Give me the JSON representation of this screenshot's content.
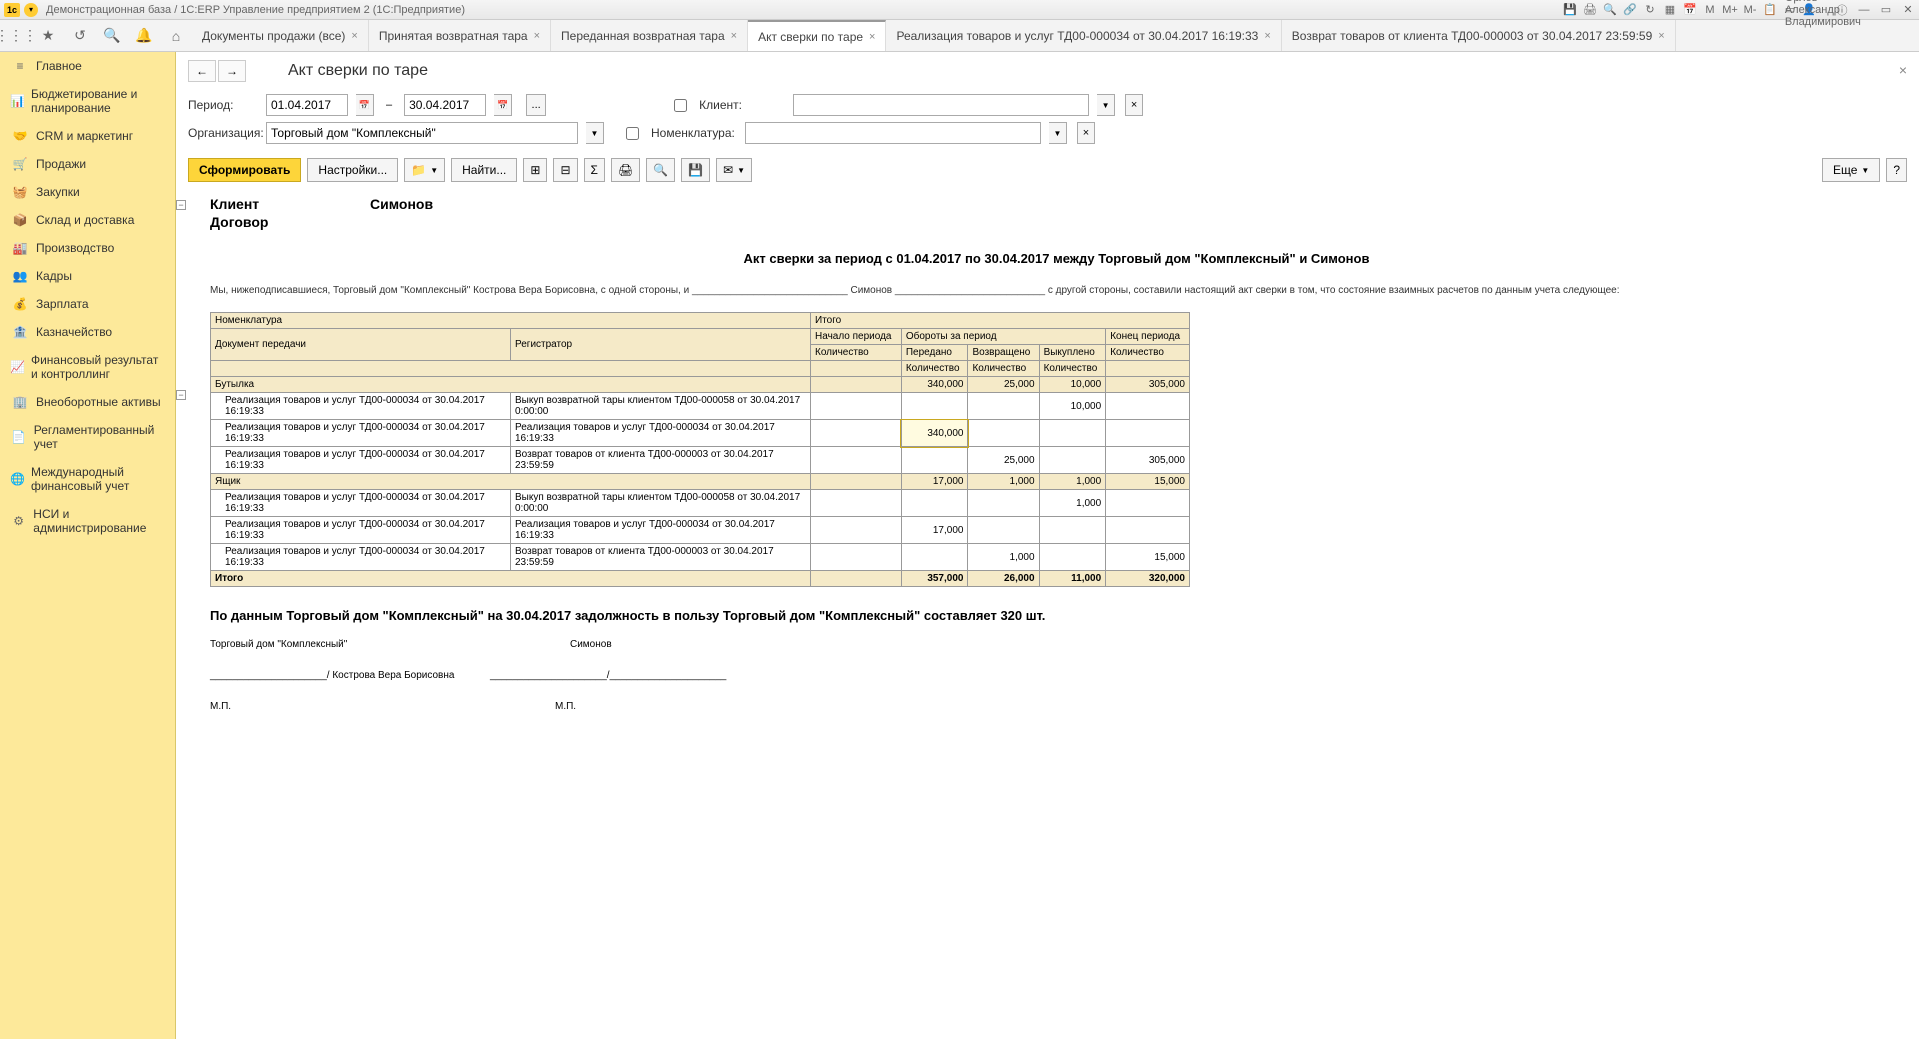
{
  "titlebar": {
    "title": "Демонстрационная база / 1С:ERP Управление предприятием 2  (1С:Предприятие)",
    "user": "Орлов Александр Владимирович"
  },
  "tabs": [
    "Документы продажи (все)",
    "Принятая возвратная тара",
    "Переданная возвратная тара",
    "Акт сверки по таре",
    "Реализация товаров и услуг ТД00-000034 от 30.04.2017 16:19:33",
    "Возврат товаров от клиента ТД00-000003 от 30.04.2017 23:59:59"
  ],
  "sidebar": [
    "Главное",
    "Бюджетирование и планирование",
    "CRM и маркетинг",
    "Продажи",
    "Закупки",
    "Склад и доставка",
    "Производство",
    "Кадры",
    "Зарплата",
    "Казначейство",
    "Финансовый результат и контроллинг",
    "Внеоборотные активы",
    "Регламентированный учет",
    "Международный финансовый учет",
    "НСИ и администрирование"
  ],
  "page": {
    "title": "Акт сверки по таре",
    "period_label": "Период:",
    "date_from": "01.04.2017",
    "date_to": "30.04.2017",
    "org_label": "Организация:",
    "org_value": "Торговый дом \"Комплексный\"",
    "client_label": "Клиент:",
    "nomen_label": "Номенклатура:"
  },
  "toolbar": {
    "form": "Сформировать",
    "settings": "Настройки...",
    "find": "Найти...",
    "more": "Еще"
  },
  "report": {
    "client_label": "Клиент",
    "client_value": "Симонов",
    "contract_label": "Договор",
    "title": "Акт сверки за период с 01.04.2017 по 30.04.2017 между Торговый дом \"Комплексный\" и Симонов",
    "preamble1": "Мы, нижеподписавшиеся,  Торговый дом \"Комплексный\" Кострова Вера Борисовна, с одной стороны, и ____________________________ Симонов",
    "preamble2": "___________________________ с другой стороны, составили настоящий акт сверки в том, что состояние взаимных расчетов по данным учета следующее:",
    "headers": {
      "h1": "Номенклатура",
      "h2": "Итого",
      "h3": "Документ передачи",
      "h4": "Регистратор",
      "h5": "Начало периода",
      "h6": "Обороты за период",
      "h7": "Конец периода",
      "h8": "Количество",
      "h9": "Передано",
      "h10": "Возвращено",
      "h11": "Выкуплено",
      "h12": "Количество",
      "h13": "Количество",
      "h14": "Количество",
      "h15": "Количество"
    },
    "group1": {
      "name": "Бутылка",
      "peredano": "340,000",
      "vozvr": "25,000",
      "vykup": "10,000",
      "konec": "305,000",
      "rows": [
        {
          "doc": "Реализация товаров и услуг ТД00-000034 от 30.04.2017 16:19:33",
          "reg": "Выкуп возвратной тары клиентом ТД00-000058 от 30.04.2017 0:00:00",
          "c3": "",
          "c4": "",
          "c5": "10,000",
          "c6": ""
        },
        {
          "doc": "Реализация товаров и услуг ТД00-000034 от 30.04.2017 16:19:33",
          "reg": "Реализация товаров и услуг ТД00-000034 от 30.04.2017 16:19:33",
          "c3": "340,000",
          "c4": "",
          "c5": "",
          "c6": "",
          "hl": true
        },
        {
          "doc": "Реализация товаров и услуг ТД00-000034 от 30.04.2017 16:19:33",
          "reg": "Возврат товаров от клиента ТД00-000003 от 30.04.2017 23:59:59",
          "c3": "",
          "c4": "25,000",
          "c5": "",
          "c6": "305,000"
        }
      ]
    },
    "group2": {
      "name": "Ящик",
      "peredano": "17,000",
      "vozvr": "1,000",
      "vykup": "1,000",
      "konec": "15,000",
      "rows": [
        {
          "doc": "Реализация товаров и услуг ТД00-000034 от 30.04.2017 16:19:33",
          "reg": "Выкуп возвратной тары клиентом ТД00-000058 от 30.04.2017 0:00:00",
          "c3": "",
          "c4": "",
          "c5": "1,000",
          "c6": ""
        },
        {
          "doc": "Реализация товаров и услуг ТД00-000034 от 30.04.2017 16:19:33",
          "reg": "Реализация товаров и услуг ТД00-000034 от 30.04.2017 16:19:33",
          "c3": "17,000",
          "c4": "",
          "c5": "",
          "c6": ""
        },
        {
          "doc": "Реализация товаров и услуг ТД00-000034 от 30.04.2017 16:19:33",
          "reg": "Возврат товаров от клиента ТД00-000003 от 30.04.2017 23:59:59",
          "c3": "",
          "c4": "1,000",
          "c5": "",
          "c6": "15,000"
        }
      ]
    },
    "total": {
      "name": "Итого",
      "c3": "357,000",
      "c4": "26,000",
      "c5": "11,000",
      "c6": "320,000"
    },
    "summary": "По данным Торговый дом \"Комплексный\" на 30.04.2017 задолжность в пользу Торговый дом \"Комплексный\" составляет 320 шт.",
    "sig1": "Торговый дом \"Комплексный\"",
    "sig2": "Симонов",
    "sign_name": "_____________________/ Кострова Вера Борисовна",
    "sign_name2": "_____________________/_____________________",
    "mp": "М.П."
  }
}
